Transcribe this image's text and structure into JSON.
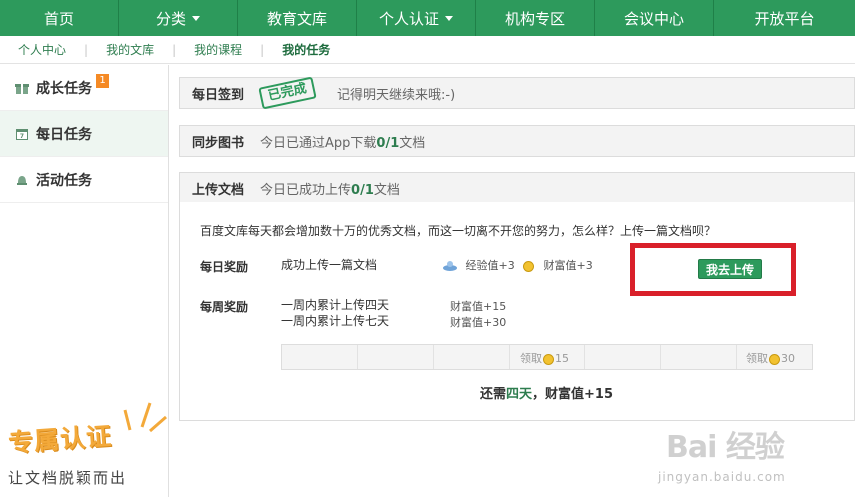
{
  "topnav": [
    {
      "label": "首页",
      "dropdown": false
    },
    {
      "label": "分类",
      "dropdown": true
    },
    {
      "label": "教育文库",
      "dropdown": false
    },
    {
      "label": "个人认证",
      "dropdown": true
    },
    {
      "label": "机构专区",
      "dropdown": false
    },
    {
      "label": "会议中心",
      "dropdown": false
    },
    {
      "label": "开放平台",
      "dropdown": false
    }
  ],
  "subnav": [
    "个人中心",
    "我的文库",
    "我的课程",
    "我的任务"
  ],
  "subnav_active": "我的任务",
  "sidebar": {
    "items": [
      {
        "label": "成长任务",
        "badge": "1",
        "icon": "gift-icon"
      },
      {
        "label": "每日任务",
        "icon": "calendar-icon"
      },
      {
        "label": "活动任务",
        "icon": "bell-icon"
      }
    ]
  },
  "promo": {
    "big": "专属认证",
    "small": "让文档脱颖而出"
  },
  "tasks": {
    "checkin": {
      "title": "每日签到",
      "stamp": "已完成",
      "text": "记得明天继续来哦:-)"
    },
    "sync": {
      "title": "同步图书",
      "text_prefix": "今日已通过App下载",
      "count": "0/1",
      "text_suffix": "文档"
    },
    "upload": {
      "title": "上传文档",
      "text_prefix": "今日已成功上传",
      "count": "0/1",
      "text_suffix": "文档"
    }
  },
  "upload_detail": {
    "intro": "百度文库每天都会增加数十万的优秀文档，而这一切离不开您的努力，怎么样？上传一篇文档呗？",
    "daily_label": "每日奖励",
    "daily_task": "成功上传一篇文档",
    "daily_exp": "经验值+3",
    "daily_wealth": "财富值+3",
    "go_button": "我去上传",
    "weekly_label": "每周奖励",
    "weekly_task1": "一周内累计上传四天",
    "weekly_task2": "一周内累计上传七天",
    "weekly_reward1": "财富值+15",
    "weekly_reward2": "财富值+30",
    "claim_label": "领取",
    "claim1": "15",
    "claim2": "30",
    "remain_prefix": "还需",
    "remain_days": "四天",
    "remain_suffix": "，财富值+15"
  },
  "watermark": {
    "main": "Bai 经验",
    "sub": "jingyan.baidu.com"
  }
}
